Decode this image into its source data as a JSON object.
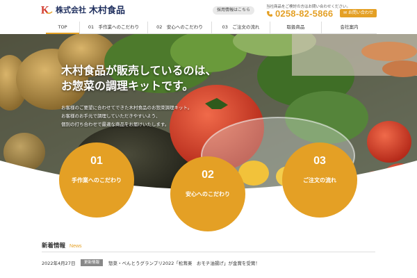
{
  "header": {
    "logo_letter": "K",
    "logo_small": "株式会社",
    "logo_big": "木村食品",
    "recruit_label": "採用情報はこちら",
    "contact_note": "当社商品をご検討の方はお問い合わせください。",
    "phone": "0258-82-5866",
    "inquiry_label": "お問い合わせ"
  },
  "nav": {
    "items": [
      {
        "label": "TOP"
      },
      {
        "label": "01　手作業へのこだわり"
      },
      {
        "label": "02　安心へのこだわり"
      },
      {
        "label": "03　ご注文の流れ"
      },
      {
        "label": "取扱商品"
      },
      {
        "label": "会社案内"
      }
    ]
  },
  "hero": {
    "title_line1": "木村食品が販売しているのは、",
    "title_line2": "お惣菜の調理キットです。",
    "text_line1": "お客様のご要望に合わせてできた木村食品のお惣菜調理キット。",
    "text_line2": "お客様のお手元で調理していただきやすいよう、",
    "text_line3": "個別の打ち合わせで最適な商品をお届けいたします。"
  },
  "features": [
    {
      "num": "01",
      "label": "手作業へのこだわり"
    },
    {
      "num": "02",
      "label": "安心へのこだわり"
    },
    {
      "num": "03",
      "label": "ご注文の流れ"
    }
  ],
  "news": {
    "title": "新着情報",
    "subtitle": "News",
    "items": [
      {
        "date": "2022年4月27日",
        "badge": "更新情報",
        "text": "惣菜・べんとうグランプリ2022「松茸楽　おモチ油揚げ」が金賞を受賞！"
      }
    ]
  },
  "colors": {
    "accent": "#e4a025",
    "navy": "#1f2f5e",
    "logo_red": "#d23b2e"
  }
}
